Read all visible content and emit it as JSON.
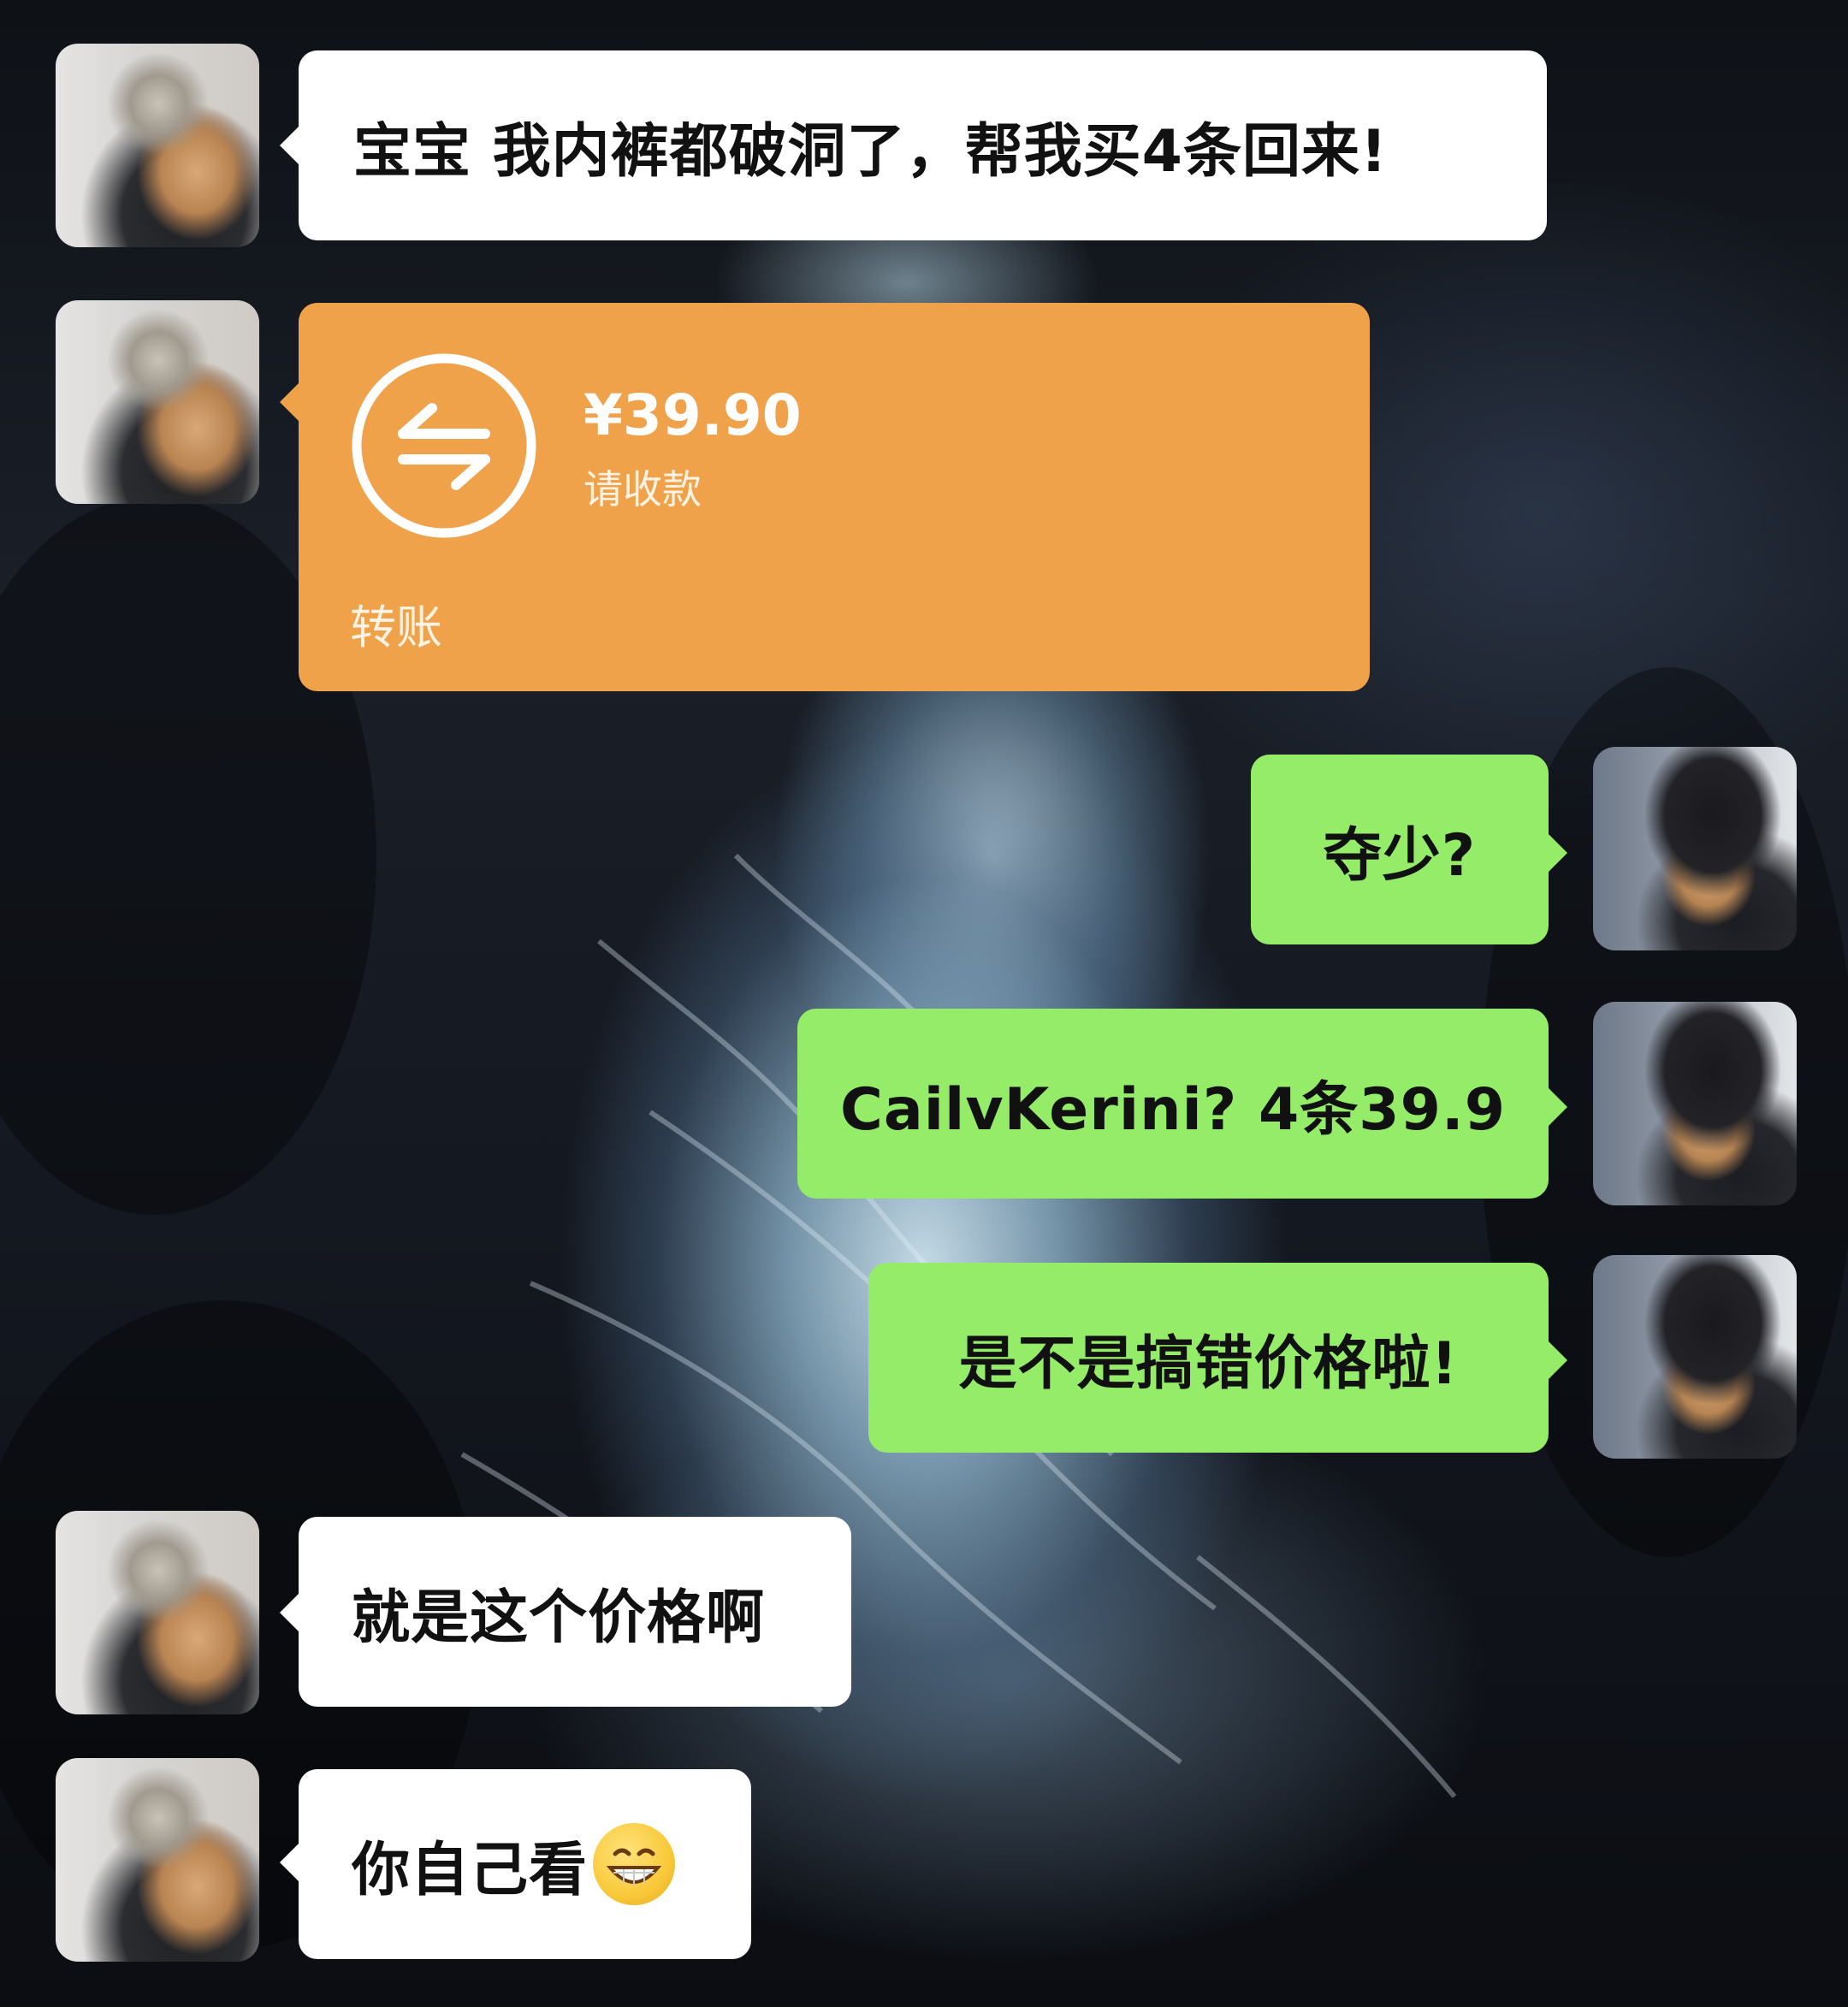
{
  "messages": [
    {
      "side": "left",
      "text": "宝宝 我内裤都破洞了，帮我买4条回来!"
    },
    {
      "side": "left",
      "type": "transfer",
      "amount": "¥39.90",
      "status": "请收款",
      "label": "转账",
      "icon": "transfer-arrows-icon"
    },
    {
      "side": "right",
      "text": "夺少?"
    },
    {
      "side": "right",
      "text": "CailvKerini?  4条39.9"
    },
    {
      "side": "right",
      "text": "是不是搞错价格啦!"
    },
    {
      "side": "left",
      "text": "就是这个价格啊"
    },
    {
      "side": "left",
      "text": "你自己看",
      "emoji": "grinning-face-emoji"
    }
  ],
  "colors": {
    "sent_bubble": "#95ec69",
    "received_bubble": "#ffffff",
    "transfer_card": "#f0a24b"
  }
}
